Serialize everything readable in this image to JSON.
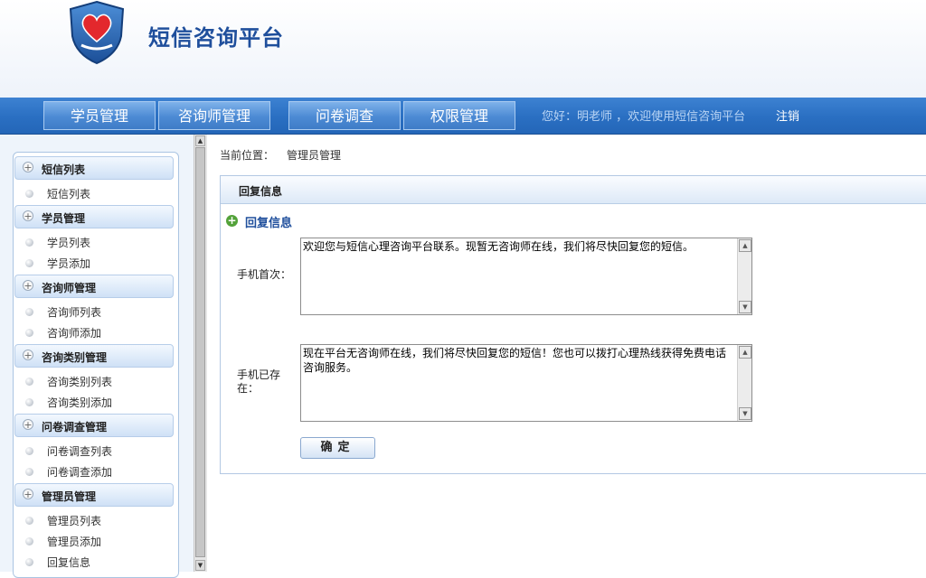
{
  "site": {
    "title": "短信咨询平台",
    "logo_icon": "heart-shield-icon"
  },
  "nav": {
    "tabs": [
      "学员管理",
      "咨询师管理",
      "问卷调查",
      "权限管理"
    ],
    "greeting": "您好：明老师 ，欢迎使用短信咨询平台",
    "logout": "注销"
  },
  "sidebar": {
    "groups": [
      {
        "label": "短信列表",
        "items": [
          "短信列表"
        ]
      },
      {
        "label": "学员管理",
        "items": [
          "学员列表",
          "学员添加"
        ]
      },
      {
        "label": "咨询师管理",
        "items": [
          "咨询师列表",
          "咨询师添加"
        ]
      },
      {
        "label": "咨询类别管理",
        "items": [
          "咨询类别列表",
          "咨询类别添加"
        ]
      },
      {
        "label": "问卷调查管理",
        "items": [
          "问卷调查列表",
          "问卷调查添加"
        ]
      },
      {
        "label": "管理员管理",
        "items": [
          "管理员列表",
          "管理员添加",
          "回复信息"
        ]
      }
    ]
  },
  "main": {
    "breadcrumb_label": "当前位置：",
    "breadcrumb_value": "管理员管理",
    "panel_title": "回复信息",
    "section_title": "回复信息",
    "fields": [
      {
        "label": "手机首次：",
        "value": "欢迎您与短信心理咨询平台联系。现暂无咨询师在线，我们将尽快回复您的短信。"
      },
      {
        "label": "手机已存在：",
        "value": "现在平台无咨询师在线，我们将尽快回复您的短信！您也可以拨打心理热线获得免费电话咨询服务。"
      }
    ],
    "submit_label": "确定"
  },
  "colors": {
    "nav_blue": "#2a6fc2",
    "title_blue": "#1f4f9c",
    "add_green": "#53a23a"
  }
}
